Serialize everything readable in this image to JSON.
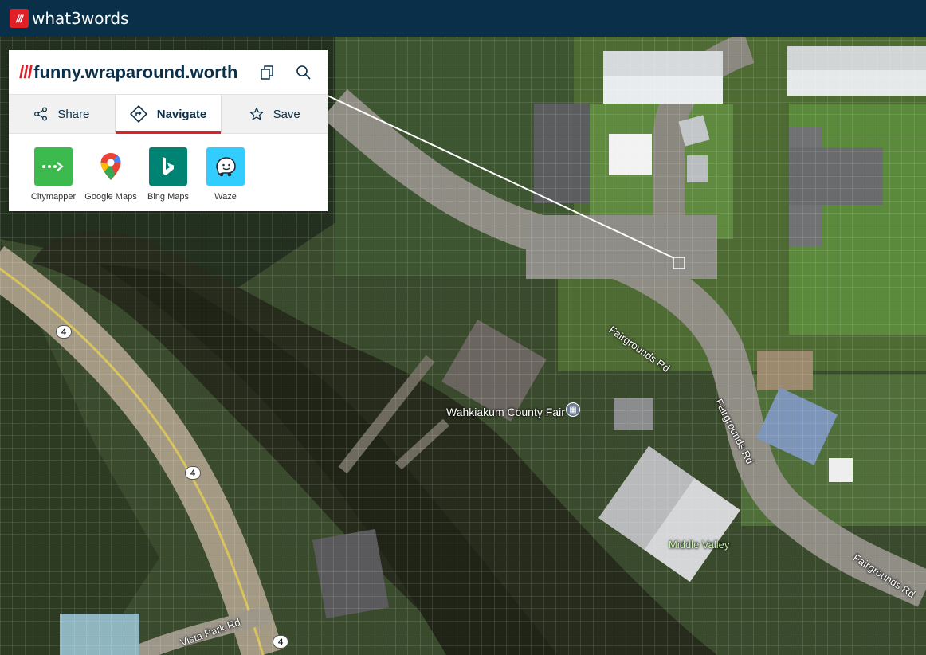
{
  "brand": {
    "logo_mark": "///",
    "name": "what3words",
    "accent": "#e11f26",
    "navy": "#0a3049"
  },
  "location": {
    "slashes": "///",
    "words": "funny.wraparound.worth"
  },
  "header_actions": [
    {
      "icon": "copy-icon"
    },
    {
      "icon": "search-icon"
    }
  ],
  "tabs": [
    {
      "label": "Share",
      "icon": "share-icon",
      "active": false
    },
    {
      "label": "Navigate",
      "icon": "navigate-icon",
      "active": true
    },
    {
      "label": "Save",
      "icon": "star-icon",
      "active": false
    }
  ],
  "nav_apps": [
    {
      "label": "Citymapper",
      "icon": "citymapper-icon",
      "color": "#3dba4e"
    },
    {
      "label": "Google Maps",
      "icon": "google-maps-icon",
      "color": "#ffffff"
    },
    {
      "label": "Bing Maps",
      "icon": "bing-maps-icon",
      "color": "#008373"
    },
    {
      "label": "Waze",
      "icon": "waze-icon",
      "color": "#33ccff"
    }
  ],
  "map": {
    "labels": {
      "fairgrounds_1": "Fairgrounds Rd",
      "fairgrounds_2": "Fairgrounds Rd",
      "fairgrounds_3": "Fairgrounds Rd",
      "vista_park": "Vista Park Rd",
      "fair": "Wahkiakum County Fair",
      "middle_valley": "Middle Valley"
    },
    "route_shields": [
      "4",
      "4",
      "4"
    ]
  }
}
